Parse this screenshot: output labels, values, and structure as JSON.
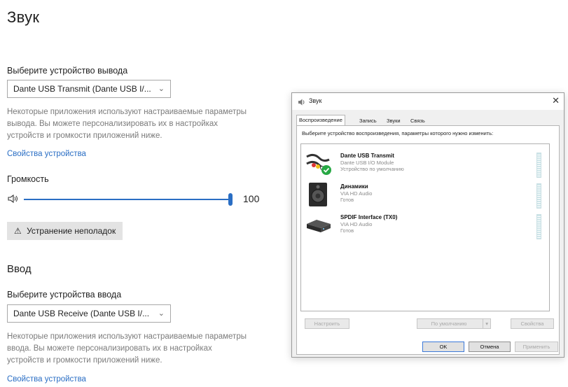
{
  "settings": {
    "title": "Звук",
    "output": {
      "label": "Выберите устройство вывода",
      "selected": "Dante USB Transmit (Dante USB I/...",
      "description": [
        "Некоторые приложения используют настраиваемые параметры",
        "вывода. Вы можете персонализировать их в настройках",
        "устройств и громкости приложений ниже."
      ],
      "device_props_link": "Свойства устройства",
      "volume_label": "Громкость",
      "volume_value": "100",
      "volume_level": 1.0,
      "troubleshoot_label": "Устранение неполадок"
    },
    "input": {
      "section_title": "Ввод",
      "label": "Выберите устройства ввода",
      "selected": "Dante USB Receive (Dante USB I/...",
      "description": [
        "Некоторые приложения используют настраиваемые параметры",
        "ввода. Вы можете персонализировать их в настройках",
        "устройств и громкости приложений ниже."
      ],
      "device_props_link": "Свойства устройства"
    }
  },
  "dialog": {
    "title": "Звук",
    "close_glyph": "✕",
    "tabs": [
      "Воспроизведение",
      "Запись",
      "Звуки",
      "Связь"
    ],
    "active_tab": 0,
    "instruction": "Выберите устройство воспроизведения, параметры которого нужно изменить:",
    "devices": [
      {
        "name": "Dante USB Transmit",
        "line1": "Dante USB I/O Module",
        "line2": "Устройство по умолчанию",
        "icon": "dante-cable-icon",
        "default": true
      },
      {
        "name": "Динамики",
        "line1": "VIA HD Audio",
        "line2": "Готов",
        "icon": "speaker-icon",
        "default": false
      },
      {
        "name": "SPDIF Interface (TX0)",
        "line1": "VIA HD Audio",
        "line2": "Готов",
        "icon": "spdif-device-icon",
        "default": false
      }
    ],
    "buttons": {
      "configure": "Настроить",
      "set_default": "По умолчанию",
      "properties": "Свойства",
      "ok": "OK",
      "cancel": "Отмена",
      "apply": "Применить"
    }
  }
}
